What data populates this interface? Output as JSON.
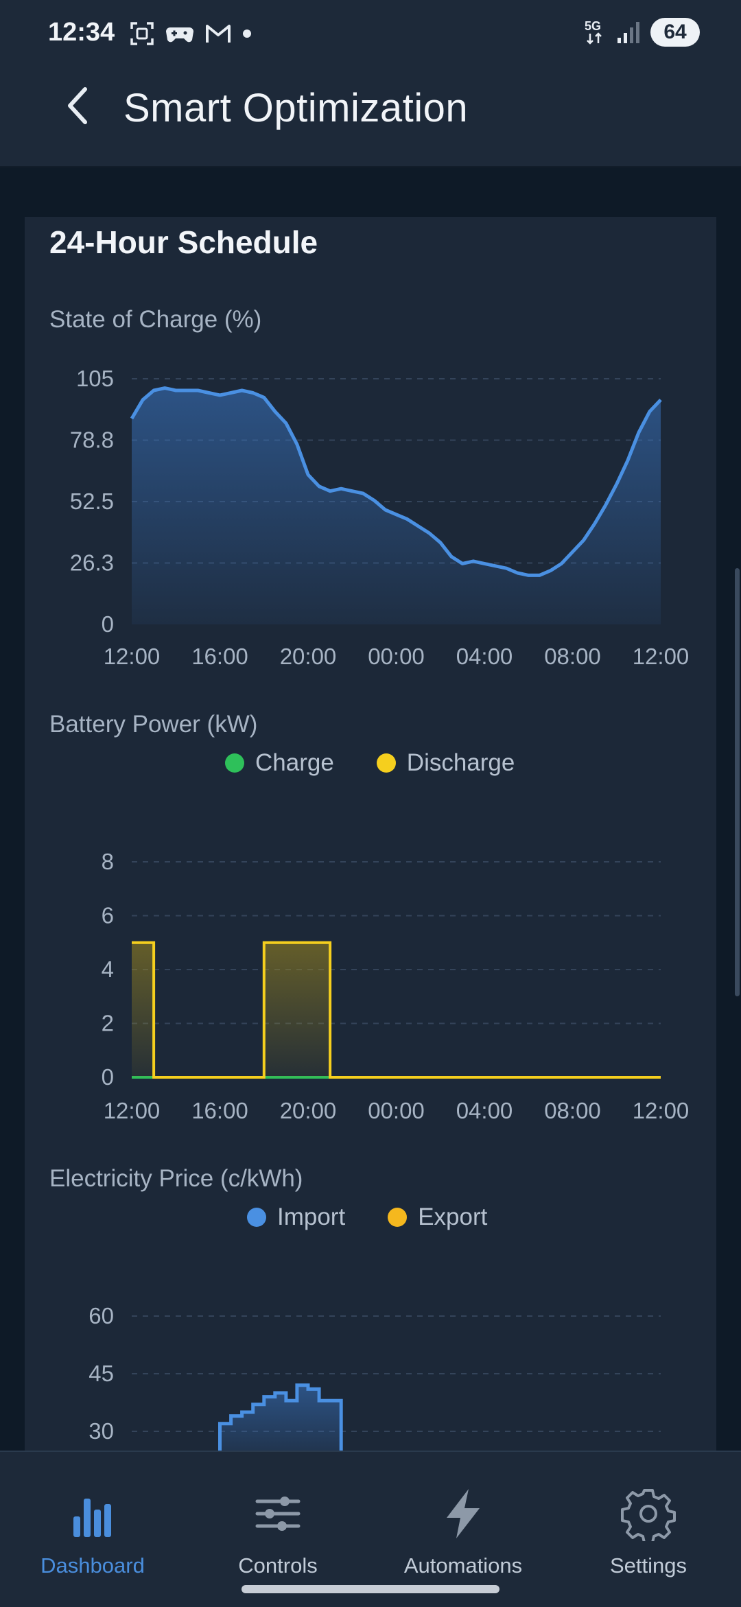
{
  "status_bar": {
    "time": "12:34",
    "network": "5G",
    "battery": "64"
  },
  "header": {
    "title": "Smart Optimization"
  },
  "schedule": {
    "title": "24-Hour Schedule"
  },
  "chart_data": [
    {
      "type": "area",
      "title": "State of Charge (%)",
      "x_ticks": [
        "12:00",
        "16:00",
        "20:00",
        "00:00",
        "04:00",
        "08:00",
        "12:00"
      ],
      "y_ticks": [
        "105",
        "78.8",
        "52.5",
        "26.3",
        "0"
      ],
      "ylim": [
        0,
        105
      ],
      "xlim": [
        0,
        24
      ],
      "x": [
        0,
        0.5,
        1,
        1.5,
        2,
        2.5,
        3,
        3.5,
        4,
        4.5,
        5,
        5.5,
        6,
        6.5,
        7,
        7.5,
        8,
        8.5,
        9,
        9.5,
        10,
        10.5,
        11,
        11.5,
        12,
        12.5,
        13,
        13.5,
        14,
        14.5,
        15,
        15.5,
        16,
        16.5,
        17,
        17.5,
        18,
        18.5,
        19,
        19.5,
        20,
        20.5,
        21,
        21.5,
        22,
        22.5,
        23,
        23.5,
        24
      ],
      "values": [
        88,
        96,
        100,
        101,
        100,
        100,
        100,
        99,
        98,
        99,
        100,
        99,
        97,
        91,
        86,
        77,
        64,
        59,
        57,
        58,
        57,
        56,
        53,
        49,
        47,
        45,
        42,
        39,
        35,
        29,
        26,
        27,
        26,
        25,
        24,
        22,
        21,
        21,
        23,
        26,
        31,
        36,
        43,
        51,
        60,
        70,
        82,
        91,
        96
      ],
      "color": "#4a90e2",
      "grid": true
    },
    {
      "type": "step",
      "title": "Battery Power (kW)",
      "legend": [
        {
          "name": "Charge",
          "color": "#2ec05a"
        },
        {
          "name": "Discharge",
          "color": "#f5cf1e"
        }
      ],
      "x_ticks": [
        "12:00",
        "16:00",
        "20:00",
        "00:00",
        "04:00",
        "08:00",
        "12:00"
      ],
      "y_ticks": [
        "8",
        "6",
        "4",
        "2",
        "0"
      ],
      "ylim": [
        0,
        8
      ],
      "xlim": [
        0,
        24
      ],
      "series": [
        {
          "name": "Charge",
          "color": "#2ec05a",
          "segments": [
            [
              0,
              24,
              0
            ]
          ]
        },
        {
          "name": "Discharge",
          "color": "#f5cf1e",
          "segments": [
            [
              0,
              1,
              5
            ],
            [
              1,
              6,
              0
            ],
            [
              6,
              9,
              5
            ],
            [
              9,
              24,
              0
            ]
          ]
        }
      ],
      "grid": true
    },
    {
      "type": "step",
      "title": "Electricity Price (c/kWh)",
      "legend": [
        {
          "name": "Import",
          "color": "#4a90e2"
        },
        {
          "name": "Export",
          "color": "#f5b81e"
        }
      ],
      "y_ticks": [
        "60",
        "45",
        "30"
      ],
      "ylim": [
        0,
        60
      ],
      "xlim": [
        0,
        24
      ],
      "series": [
        {
          "name": "Import",
          "color": "#4a90e2",
          "x": [
            4,
            4.5,
            5,
            5.5,
            6,
            6.5,
            7,
            7.5,
            8,
            8.5,
            9
          ],
          "values": [
            32,
            34,
            35,
            37,
            39,
            40,
            38,
            42,
            41,
            38,
            38
          ]
        }
      ],
      "grid": true
    }
  ],
  "nav": {
    "items": [
      {
        "label": "Dashboard",
        "icon": "bar-chart-icon",
        "active": true
      },
      {
        "label": "Controls",
        "icon": "sliders-icon",
        "active": false
      },
      {
        "label": "Automations",
        "icon": "lightning-icon",
        "active": false
      },
      {
        "label": "Settings",
        "icon": "gear-icon",
        "active": false
      }
    ]
  }
}
